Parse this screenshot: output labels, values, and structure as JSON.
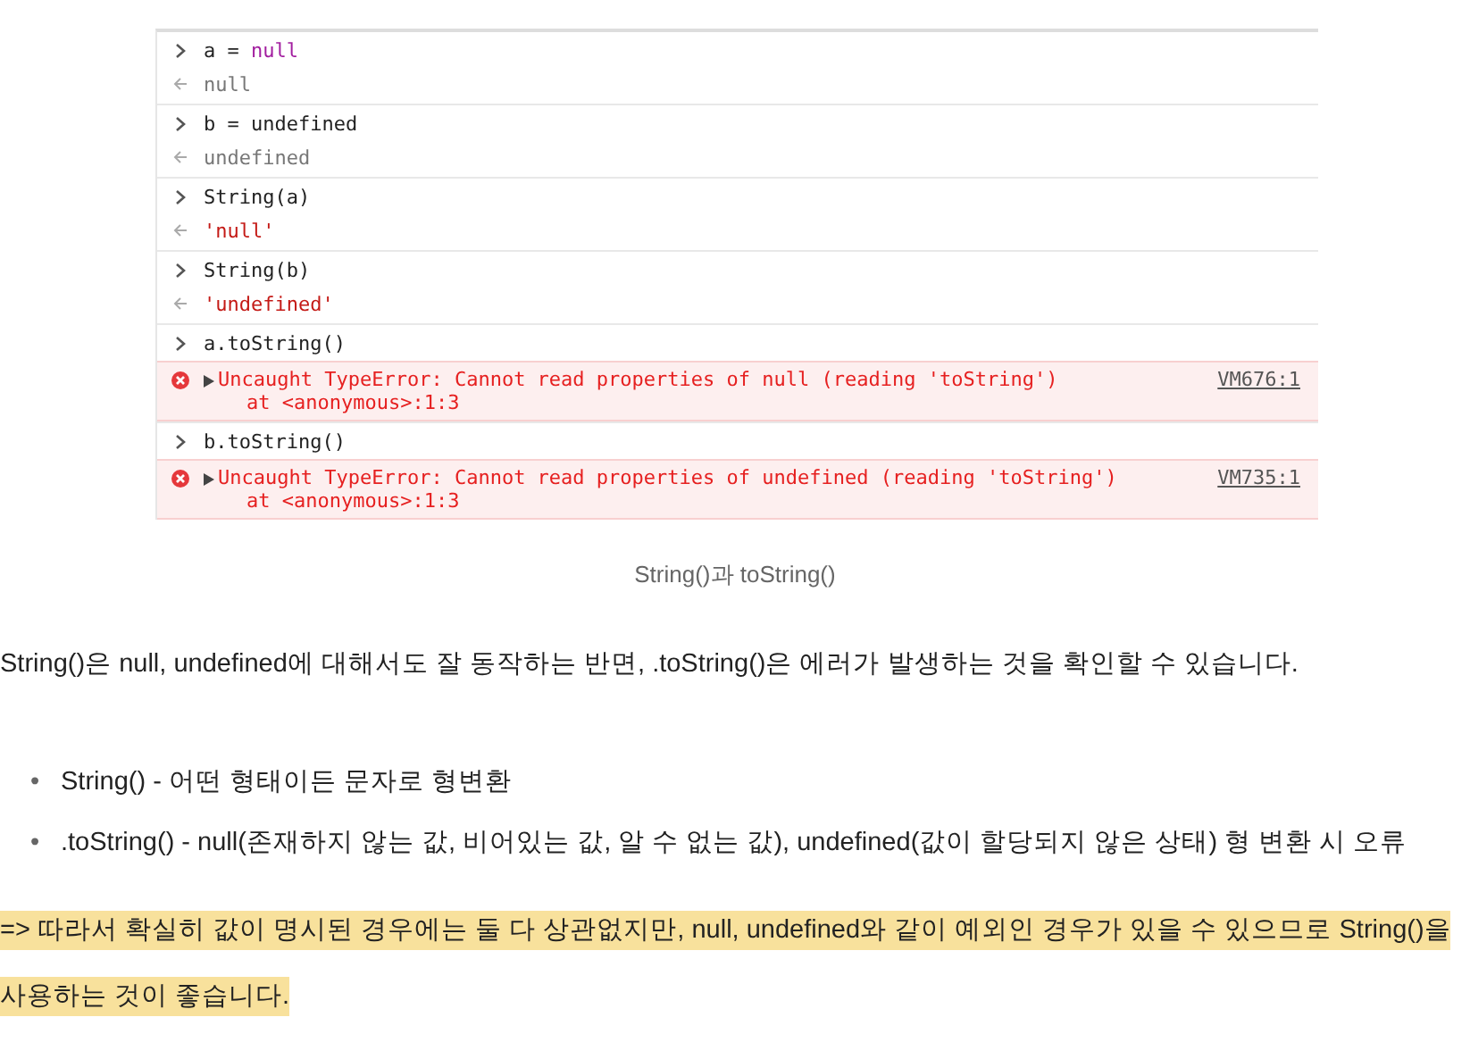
{
  "console": {
    "entries": [
      {
        "input": [
          {
            "text": "a = ",
            "kind": "plain"
          },
          {
            "text": "null",
            "kind": "keyword"
          }
        ],
        "output": {
          "kind": "result",
          "text": "null"
        }
      },
      {
        "input": [
          {
            "text": "b = undefined",
            "kind": "plain"
          }
        ],
        "output": {
          "kind": "result",
          "text": "undefined"
        }
      },
      {
        "input": [
          {
            "text": "String(a)",
            "kind": "plain"
          }
        ],
        "output": {
          "kind": "string",
          "text": "'null'"
        }
      },
      {
        "input": [
          {
            "text": "String(b)",
            "kind": "plain"
          }
        ],
        "output": {
          "kind": "string",
          "text": "'undefined'"
        }
      },
      {
        "input": [
          {
            "text": "a.toString()",
            "kind": "plain"
          }
        ],
        "output": {
          "kind": "error",
          "text": "Uncaught TypeError: Cannot read properties of null (reading 'toString')",
          "trace": "at <anonymous>:1:3",
          "source": "VM676:1",
          "expanded": false
        }
      },
      {
        "input": [
          {
            "text": "b.toString()",
            "kind": "plain"
          }
        ],
        "output": {
          "kind": "error",
          "text": "Uncaught TypeError: Cannot read properties of undefined (reading 'toString')",
          "trace": "at <anonymous>:1:3",
          "source": "VM735:1",
          "expanded": false
        }
      }
    ]
  },
  "caption": "String()과 toString()",
  "paragraph": "String()은 null, undefined에 대해서도 잘 동작하는 반면, .toString()은 에러가 발생하는 것을 확인할 수 있습니다.",
  "bullets": [
    {
      "marker": "•",
      "text": "String() - 어떤 형태이든 문자로 형변환"
    },
    {
      "marker": "•",
      "text": ".toString() - null(존재하지 않는 값, 비어있는 값, 알 수 없는 값), undefined(값이 할당되지 않은 상태) 형 변환 시 오류"
    }
  ],
  "highlight_lines": [
    "=> 따라서 확실히 값이 명시된 경우에는 둘 다 상관없지만, null, undefined와 같이 예외인 경우가 있을 수 있으므로 String()을",
    "사용하는 것이 좋습니다."
  ]
}
